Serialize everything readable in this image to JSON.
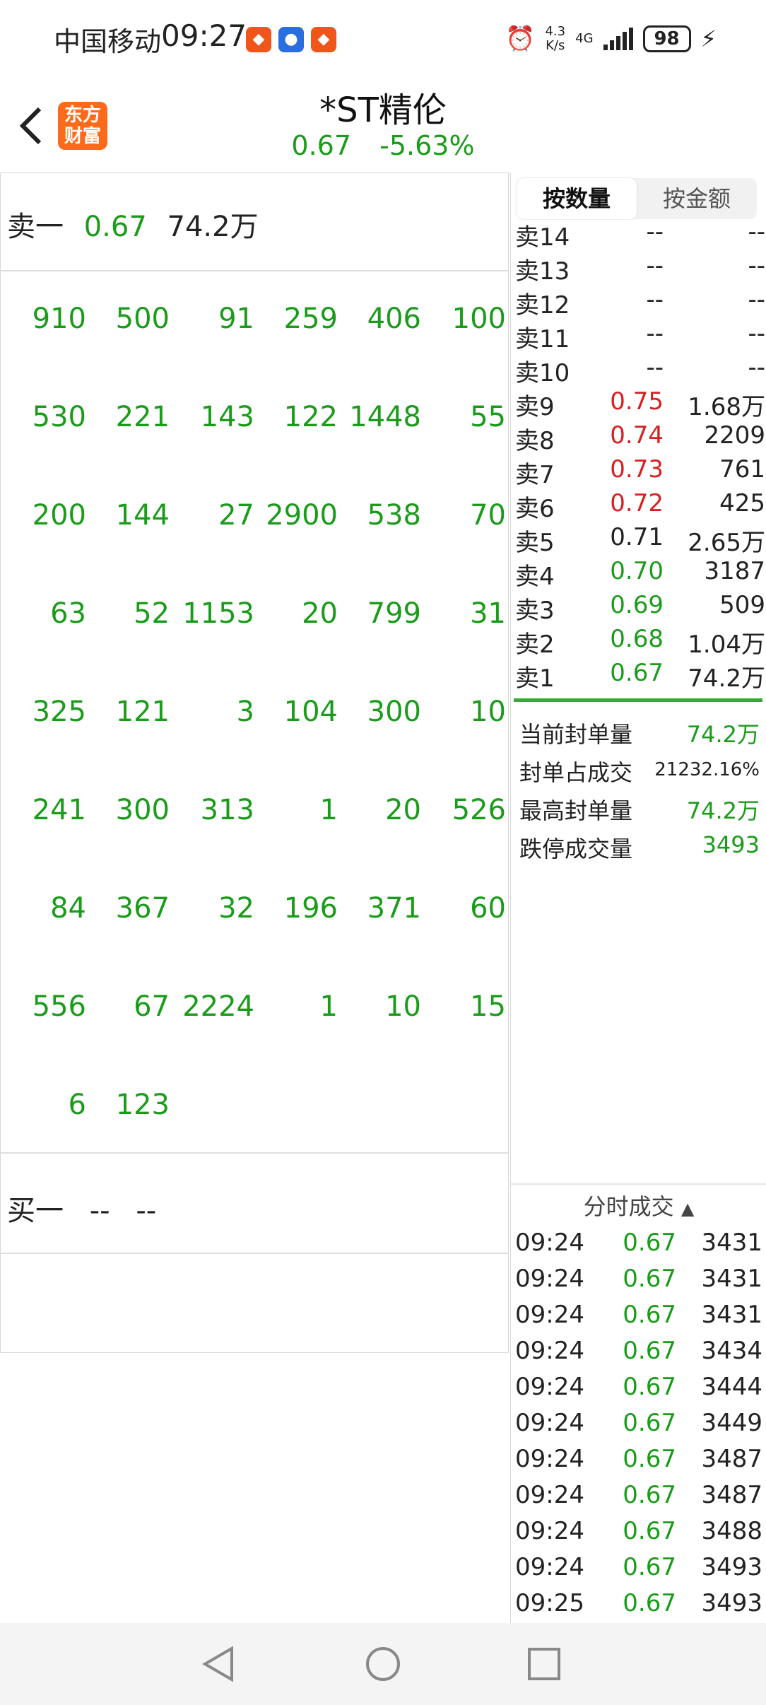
{
  "status_bar": {
    "carrier": "中国移动",
    "time": "09:27",
    "net_speed_top": "4.3",
    "net_speed_bottom": "K/s",
    "network": "4G",
    "battery": "98"
  },
  "header": {
    "logo_text": "东方财富",
    "stock_name": "*ST精伦",
    "price": "0.67",
    "change": "-5.63%"
  },
  "left_panel": {
    "sell1_label": "卖一",
    "sell1_price": "0.67",
    "sell1_volume": "74.2万",
    "queue": [
      [
        "910",
        "500",
        "91",
        "259",
        "406",
        "100"
      ],
      [
        "530",
        "221",
        "143",
        "122",
        "1448",
        "55"
      ],
      [
        "200",
        "144",
        "27",
        "2900",
        "538",
        "70"
      ],
      [
        "63",
        "52",
        "1153",
        "20",
        "799",
        "31"
      ],
      [
        "325",
        "121",
        "3",
        "104",
        "300",
        "10"
      ],
      [
        "241",
        "300",
        "313",
        "1",
        "20",
        "526"
      ],
      [
        "84",
        "367",
        "32",
        "196",
        "371",
        "60"
      ],
      [
        "556",
        "67",
        "2224",
        "1",
        "10",
        "15"
      ],
      [
        "6",
        "123"
      ]
    ],
    "buy1_label": "买一",
    "buy1_price": "--",
    "buy1_volume": "--"
  },
  "right_panel": {
    "tab_active": "按数量",
    "tab_inactive": "按金额",
    "order_book": [
      {
        "label": "卖14",
        "price": "--",
        "volume": "--",
        "color": "dark"
      },
      {
        "label": "卖13",
        "price": "--",
        "volume": "--",
        "color": "dark"
      },
      {
        "label": "卖12",
        "price": "--",
        "volume": "--",
        "color": "dark"
      },
      {
        "label": "卖11",
        "price": "--",
        "volume": "--",
        "color": "dark"
      },
      {
        "label": "卖10",
        "price": "--",
        "volume": "--",
        "color": "dark"
      },
      {
        "label": "卖9",
        "price": "0.75",
        "volume": "1.68万",
        "color": "red"
      },
      {
        "label": "卖8",
        "price": "0.74",
        "volume": "2209",
        "color": "red"
      },
      {
        "label": "卖7",
        "price": "0.73",
        "volume": "761",
        "color": "red"
      },
      {
        "label": "卖6",
        "price": "0.72",
        "volume": "425",
        "color": "red"
      },
      {
        "label": "卖5",
        "price": "0.71",
        "volume": "2.65万",
        "color": "dark"
      },
      {
        "label": "卖4",
        "price": "0.70",
        "volume": "3187",
        "color": "green"
      },
      {
        "label": "卖3",
        "price": "0.69",
        "volume": "509",
        "color": "green"
      },
      {
        "label": "卖2",
        "price": "0.68",
        "volume": "1.04万",
        "color": "green"
      },
      {
        "label": "卖1",
        "price": "0.67",
        "volume": "74.2万",
        "color": "green"
      }
    ],
    "stats": [
      {
        "label": "当前封单量",
        "value": "74.2万",
        "color": "green"
      },
      {
        "label": "封单占成交",
        "value": "21232.16%",
        "color": "dark"
      },
      {
        "label": "最高封单量",
        "value": "74.2万",
        "color": "green"
      },
      {
        "label": "跌停成交量",
        "value": "3493",
        "color": "green"
      }
    ],
    "ticks_title": "分时成交",
    "ticks": [
      {
        "time": "09:24",
        "price": "0.67",
        "volume": "3431",
        "vcolor": "dark"
      },
      {
        "time": "09:24",
        "price": "0.67",
        "volume": "3431",
        "vcolor": "dark"
      },
      {
        "time": "09:24",
        "price": "0.67",
        "volume": "3431",
        "vcolor": "dark"
      },
      {
        "time": "09:24",
        "price": "0.67",
        "volume": "3434",
        "vcolor": "dark"
      },
      {
        "time": "09:24",
        "price": "0.67",
        "volume": "3444",
        "vcolor": "dark"
      },
      {
        "time": "09:24",
        "price": "0.67",
        "volume": "3449",
        "vcolor": "dark"
      },
      {
        "time": "09:24",
        "price": "0.67",
        "volume": "3487",
        "vcolor": "dark"
      },
      {
        "time": "09:24",
        "price": "0.67",
        "volume": "3487",
        "vcolor": "dark"
      },
      {
        "time": "09:24",
        "price": "0.67",
        "volume": "3488",
        "vcolor": "dark"
      },
      {
        "time": "09:24",
        "price": "0.67",
        "volume": "3493",
        "vcolor": "dark"
      },
      {
        "time": "09:25",
        "price": "0.67",
        "volume": "3493",
        "vcolor": "red"
      }
    ]
  },
  "colors": {
    "green": "#1a9c1a",
    "red": "#d82020",
    "accent": "#ff6a1a"
  }
}
